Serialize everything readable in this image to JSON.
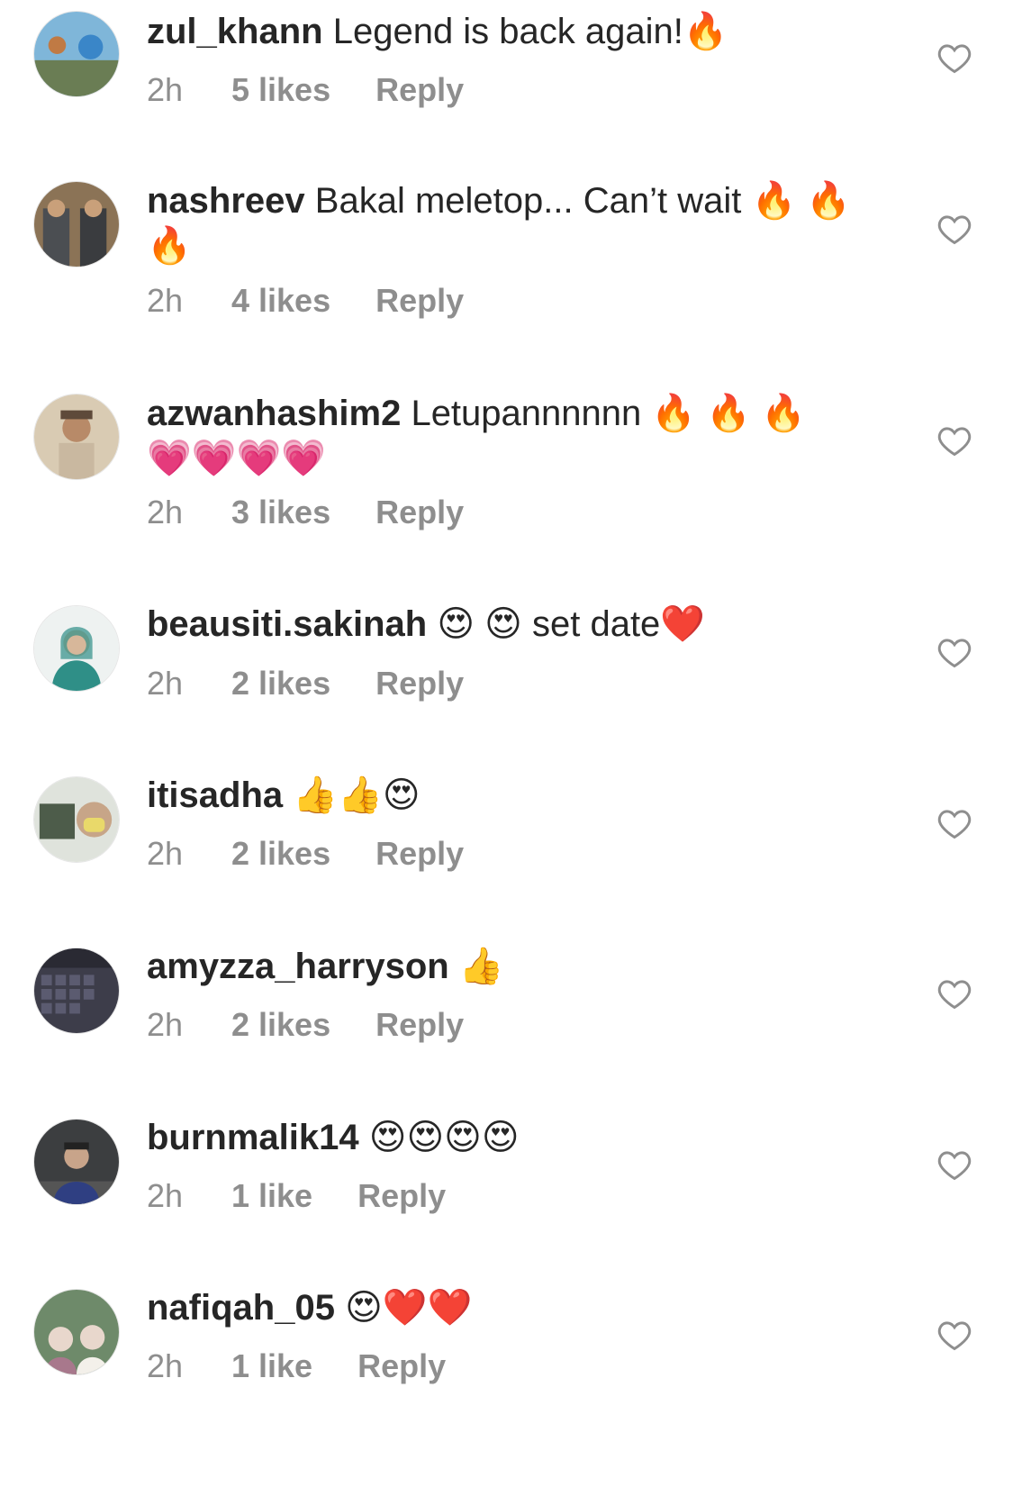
{
  "comments": [
    {
      "username": "zul_khann",
      "text": " Legend is back again!🔥",
      "time": "2h",
      "likes": "5 likes",
      "reply": "Reply",
      "avatar_colors": [
        "#3a86c8",
        "#7fb6d9",
        "#6a7d54"
      ]
    },
    {
      "username": "nashreev",
      "text": " Bakal meletop... Can’t wait  🔥 🔥 🔥",
      "time": "2h",
      "likes": "4 likes",
      "reply": "Reply",
      "avatar_colors": [
        "#4b4e52",
        "#8b7356",
        "#3a3c3f"
      ]
    },
    {
      "username": "azwanhashim2",
      "text": " Letupannnnnn  🔥 🔥 🔥 💗💗💗💗",
      "time": "2h",
      "likes": "3 likes",
      "reply": "Reply",
      "avatar_colors": [
        "#c9b8a0",
        "#d9cbb3",
        "#5e4a3a"
      ]
    },
    {
      "username": "beausiti.sakinah",
      "text": " 😍 😍  set date❤️",
      "time": "2h",
      "likes": "2 likes",
      "reply": "Reply",
      "avatar_colors": [
        "#eef2f1",
        "#2f8f87",
        "#d7b79a"
      ]
    },
    {
      "username": "itisadha",
      "text": " 👍👍😍",
      "time": "2h",
      "likes": "2 likes",
      "reply": "Reply",
      "avatar_colors": [
        "#dfe3dc",
        "#e9d96a",
        "#4d5c4a"
      ]
    },
    {
      "username": "amyzza_harryson",
      "text": " 👍",
      "time": "2h",
      "likes": "2 likes",
      "reply": "Reply",
      "avatar_colors": [
        "#3d3d4a",
        "#5b5b70",
        "#2a2a33"
      ]
    },
    {
      "username": "burnmalik14",
      "text": " 😍😍😍😍",
      "time": "2h",
      "likes": "1 like",
      "reply": "Reply",
      "avatar_colors": [
        "#3c3e40",
        "#2f3f82",
        "#c8a48a"
      ]
    },
    {
      "username": "nafiqah_05",
      "text": " 😍❤️❤️",
      "time": "2h",
      "likes": "1 like",
      "reply": "Reply",
      "avatar_colors": [
        "#6e8a6a",
        "#e8d7cc",
        "#a8788c"
      ]
    }
  ],
  "icons": {
    "like": "heart-outline-icon",
    "avatar": "avatar-photo"
  },
  "colors": {
    "text": "#262626",
    "secondary": "#8e8e8e",
    "heart_stroke": "#8e8e8e"
  }
}
